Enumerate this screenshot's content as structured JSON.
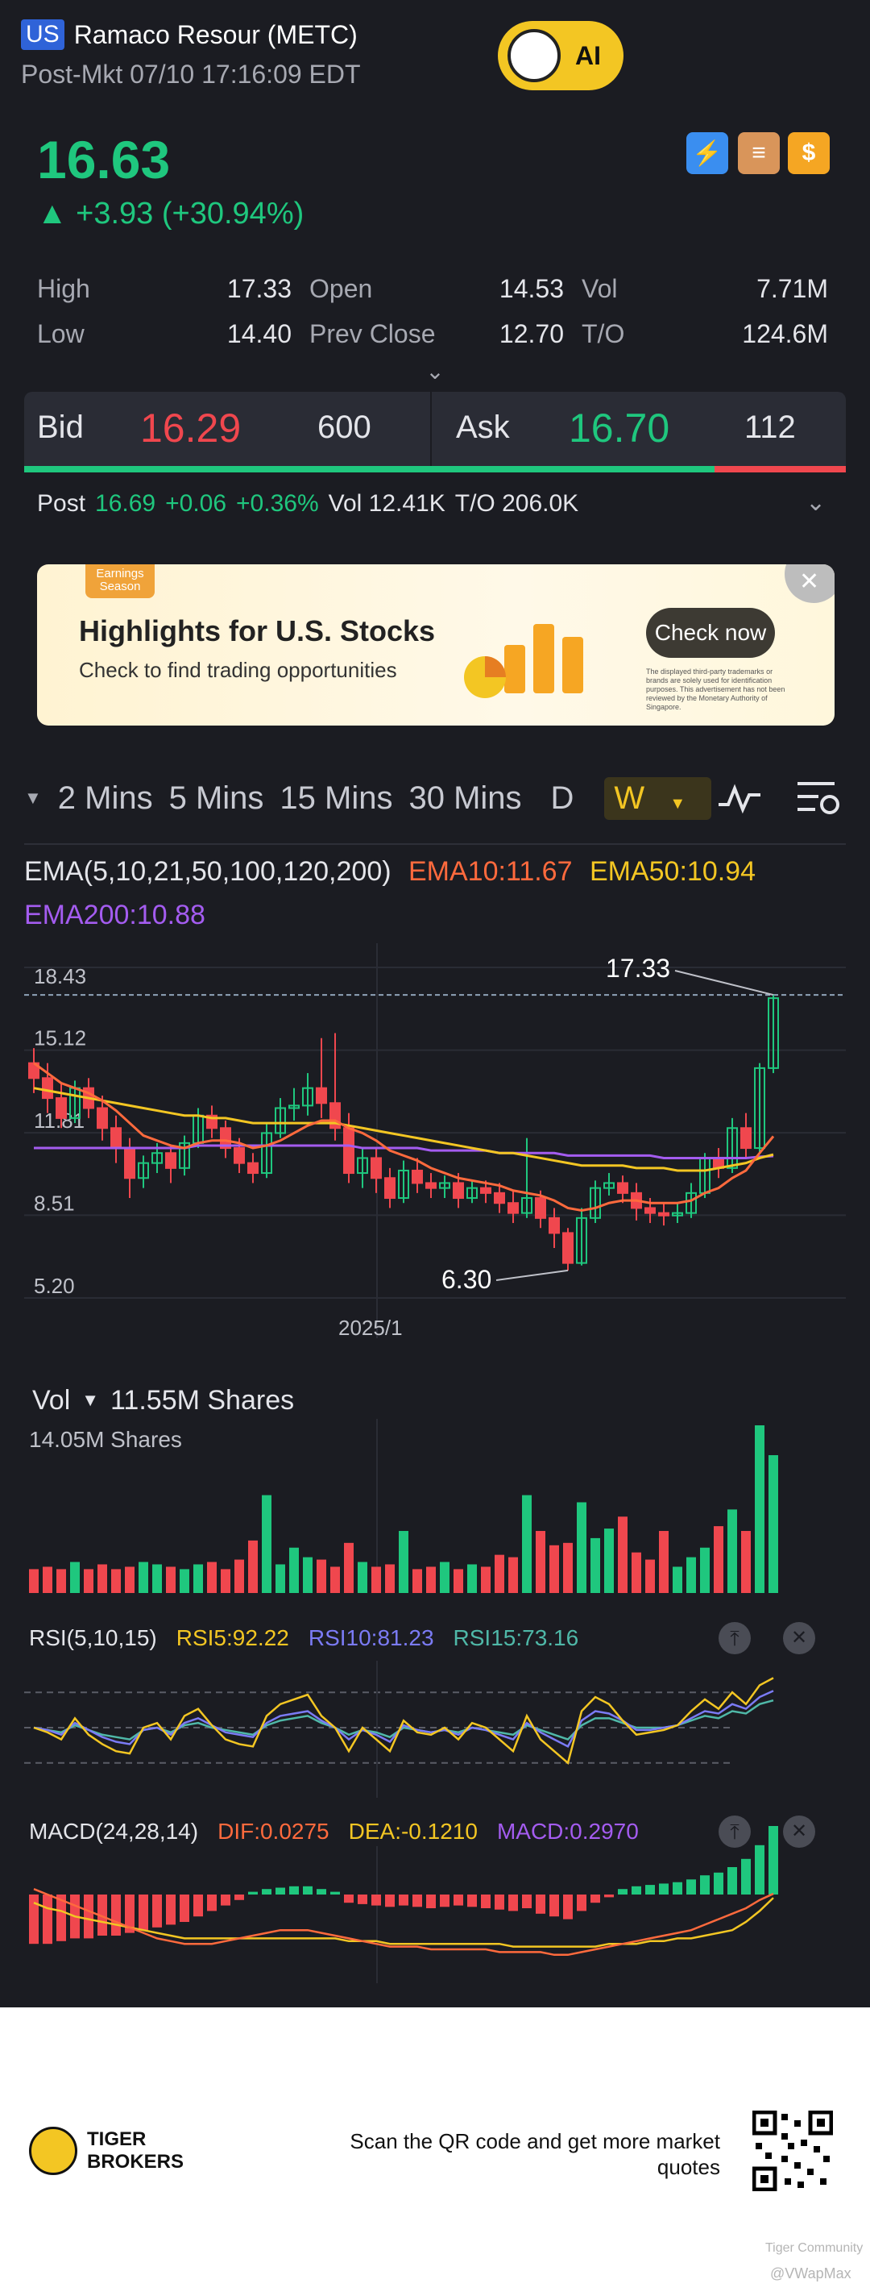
{
  "header": {
    "market_badge": "US",
    "name": "Ramaco Resour (METC)",
    "session": "Post-Mkt 07/10 17:16:09 EDT",
    "ai_label": "AI"
  },
  "quote": {
    "price": "16.63",
    "change": "▲ +3.93 (+30.94%)"
  },
  "icons": [
    {
      "name": "flash-icon",
      "glyph": "⚡",
      "sub": "1",
      "color": "#3a8ef0"
    },
    {
      "name": "stack-icon",
      "glyph": "≡",
      "color": "#e2a15a"
    },
    {
      "name": "dollar-icon",
      "glyph": "$",
      "color": "#f5a623"
    }
  ],
  "stats": [
    {
      "label": "High",
      "value": "17.33"
    },
    {
      "label": "Open",
      "value": "14.53"
    },
    {
      "label": "Vol",
      "value": "7.71M"
    },
    {
      "label": "Low",
      "value": "14.40"
    },
    {
      "label": "Prev Close",
      "value": "12.70"
    },
    {
      "label": "T/O",
      "value": "124.6M"
    }
  ],
  "bidask": {
    "bid_label": "Bid",
    "bid_price": "16.29",
    "bid_size": "600",
    "ask_label": "Ask",
    "ask_price": "16.70",
    "ask_size": "112",
    "bid_share": 0.84
  },
  "post": {
    "label": "Post",
    "price": "16.69",
    "chg": "+0.06",
    "pct": "+0.36%",
    "vol": "Vol 12.41K",
    "to": "T/O 206.0K"
  },
  "banner": {
    "tag": "Earnings Season",
    "title": "Highlights for U.S. Stocks",
    "subtitle": "Check to find trading opportunities",
    "cta": "Check now",
    "disclaimer": "The displayed third-party trademarks or brands are solely used for identification purposes. This advertisement has not been reviewed by the Monetary Authority of Singapore."
  },
  "tabs": [
    "2 Mins",
    "5 Mins",
    "15 Mins",
    "30 Mins",
    "D",
    "W"
  ],
  "ema": {
    "title": "EMA(5,10,21,50,100,120,200)",
    "ema10": "EMA10:11.67",
    "ema50": "EMA50:10.94",
    "ema200": "EMA200:10.88"
  },
  "price_axis": [
    "18.43",
    "15.12",
    "11.81",
    "8.51",
    "5.20"
  ],
  "annotations": {
    "high": "17.33",
    "low": "6.30",
    "date": "2025/1"
  },
  "vol": {
    "label": "Vol",
    "value": "11.55M Shares",
    "max": "14.05M Shares"
  },
  "rsi": {
    "title": "RSI(5,10,15)",
    "r5": "RSI5:92.22",
    "r10": "RSI10:81.23",
    "r15": "RSI15:73.16"
  },
  "macd": {
    "title": "MACD(24,28,14)",
    "dif": "DIF:0.0275",
    "dea": "DEA:-0.1210",
    "macd": "MACD:0.2970"
  },
  "footer": {
    "brand1": "TIGER",
    "brand2": "BROKERS",
    "qr_text": "Scan the QR code and get more market quotes",
    "watermark1": "Tiger Community",
    "watermark2": "@VWapMax"
  },
  "colors": {
    "up": "#1fc77e",
    "down": "#f0474e",
    "ema10": "#ff6a3d",
    "ema50": "#f3c623",
    "ema200": "#a45cf0",
    "rsi10": "#7b7bf5",
    "rsi15": "#4fb8a8"
  },
  "chart_data": {
    "type": "candlestick",
    "y_range": [
      5.2,
      18.43
    ],
    "candles": [
      [
        14.6,
        14.0,
        15.2,
        13.4
      ],
      [
        14.0,
        13.2,
        14.6,
        12.6
      ],
      [
        13.2,
        12.4,
        13.8,
        12.0
      ],
      [
        12.4,
        13.6,
        13.9,
        12.2
      ],
      [
        13.6,
        12.8,
        14.0,
        12.4
      ],
      [
        12.8,
        12.0,
        13.3,
        11.5
      ],
      [
        12.0,
        11.2,
        12.5,
        10.6
      ],
      [
        11.2,
        10.0,
        11.6,
        9.2
      ],
      [
        10.0,
        10.6,
        10.9,
        9.6
      ],
      [
        10.6,
        11.0,
        11.4,
        10.2
      ],
      [
        11.0,
        10.4,
        11.3,
        9.8
      ],
      [
        10.4,
        11.4,
        11.7,
        10.1
      ],
      [
        11.4,
        12.5,
        12.8,
        11.2
      ],
      [
        12.5,
        12.0,
        12.9,
        11.6
      ],
      [
        12.0,
        11.2,
        12.3,
        10.8
      ],
      [
        11.2,
        10.6,
        11.6,
        10.2
      ],
      [
        10.6,
        10.2,
        11.0,
        9.8
      ],
      [
        10.2,
        11.8,
        12.2,
        10.0
      ],
      [
        11.8,
        12.8,
        13.2,
        11.6
      ],
      [
        12.8,
        12.9,
        13.6,
        12.3
      ],
      [
        12.9,
        13.6,
        14.2,
        12.5
      ],
      [
        13.6,
        13.0,
        15.6,
        12.4
      ],
      [
        13.0,
        12.0,
        15.8,
        11.5
      ],
      [
        12.0,
        10.2,
        12.6,
        9.8
      ],
      [
        10.2,
        10.8,
        11.2,
        9.6
      ],
      [
        10.8,
        10.0,
        11.2,
        9.4
      ],
      [
        10.0,
        9.2,
        10.4,
        8.8
      ],
      [
        9.2,
        10.3,
        10.7,
        9.0
      ],
      [
        10.3,
        9.8,
        10.8,
        9.4
      ],
      [
        9.8,
        9.6,
        10.2,
        9.2
      ],
      [
        9.6,
        9.8,
        10.1,
        9.2
      ],
      [
        9.8,
        9.2,
        10.2,
        8.8
      ],
      [
        9.2,
        9.6,
        9.9,
        9.0
      ],
      [
        9.6,
        9.4,
        9.9,
        9.0
      ],
      [
        9.4,
        9.0,
        9.8,
        8.6
      ],
      [
        9.0,
        8.6,
        9.5,
        8.2
      ],
      [
        8.6,
        9.2,
        11.6,
        8.4
      ],
      [
        9.2,
        8.4,
        9.5,
        8.0
      ],
      [
        8.4,
        7.8,
        8.8,
        7.2
      ],
      [
        7.8,
        6.6,
        8.0,
        6.3
      ],
      [
        6.6,
        8.4,
        8.8,
        6.5
      ],
      [
        8.4,
        9.6,
        9.9,
        8.2
      ],
      [
        9.6,
        9.8,
        10.2,
        9.3
      ],
      [
        9.8,
        9.4,
        10.1,
        9.0
      ],
      [
        9.4,
        8.8,
        9.8,
        8.3
      ],
      [
        8.8,
        8.6,
        9.2,
        8.2
      ],
      [
        8.6,
        8.5,
        9.0,
        8.1
      ],
      [
        8.5,
        8.6,
        9.0,
        8.2
      ],
      [
        8.6,
        9.4,
        9.8,
        8.4
      ],
      [
        9.4,
        10.8,
        11.0,
        9.2
      ],
      [
        10.8,
        10.4,
        11.2,
        10.0
      ],
      [
        10.4,
        12.0,
        12.4,
        10.2
      ],
      [
        12.0,
        11.2,
        12.6,
        10.8
      ],
      [
        11.2,
        14.4,
        14.6,
        11.0
      ],
      [
        14.4,
        17.2,
        17.33,
        14.2
      ]
    ],
    "ema10": [
      14.6,
      14.2,
      13.8,
      13.6,
      13.4,
      13.1,
      12.7,
      12.2,
      11.7,
      11.5,
      11.3,
      11.2,
      11.4,
      11.5,
      11.5,
      11.4,
      11.2,
      11.3,
      11.5,
      11.8,
      12.1,
      12.3,
      12.3,
      12.0,
      11.8,
      11.5,
      11.1,
      10.9,
      10.7,
      10.4,
      10.2,
      10.0,
      9.9,
      9.8,
      9.7,
      9.5,
      9.4,
      9.3,
      9.1,
      8.8,
      8.7,
      8.8,
      9.0,
      9.1,
      9.1,
      9.0,
      9.0,
      9.0,
      9.1,
      9.4,
      9.6,
      10.0,
      10.3,
      11.0,
      11.67
    ],
    "ema50": [
      13.6,
      13.5,
      13.4,
      13.3,
      13.2,
      13.1,
      13.0,
      12.9,
      12.8,
      12.7,
      12.6,
      12.5,
      12.5,
      12.4,
      12.4,
      12.3,
      12.2,
      12.2,
      12.2,
      12.2,
      12.2,
      12.2,
      12.2,
      12.1,
      12.0,
      11.9,
      11.8,
      11.7,
      11.6,
      11.5,
      11.4,
      11.3,
      11.2,
      11.1,
      11.0,
      11.0,
      10.9,
      10.8,
      10.7,
      10.6,
      10.5,
      10.5,
      10.5,
      10.5,
      10.4,
      10.4,
      10.4,
      10.3,
      10.3,
      10.3,
      10.4,
      10.5,
      10.6,
      10.8,
      10.94
    ],
    "ema200": [
      11.2,
      11.2,
      11.2,
      11.2,
      11.2,
      11.2,
      11.2,
      11.2,
      11.2,
      11.2,
      11.2,
      11.2,
      11.3,
      11.3,
      11.3,
      11.3,
      11.3,
      11.3,
      11.3,
      11.3,
      11.3,
      11.3,
      11.3,
      11.3,
      11.2,
      11.2,
      11.2,
      11.2,
      11.2,
      11.1,
      11.1,
      11.1,
      11.1,
      11.1,
      11.0,
      11.0,
      11.0,
      11.0,
      11.0,
      10.9,
      10.9,
      10.9,
      10.9,
      10.9,
      10.9,
      10.9,
      10.8,
      10.8,
      10.8,
      10.8,
      10.8,
      10.8,
      10.8,
      10.85,
      10.88
    ],
    "volume": [
      2.0,
      2.2,
      2.0,
      2.6,
      2.0,
      2.4,
      2.0,
      2.2,
      2.6,
      2.4,
      2.2,
      2.0,
      2.4,
      2.6,
      2.0,
      2.8,
      4.4,
      8.2,
      2.4,
      3.8,
      3.0,
      2.8,
      2.2,
      4.2,
      2.6,
      2.2,
      2.4,
      5.2,
      2.0,
      2.2,
      2.6,
      2.0,
      2.4,
      2.2,
      3.2,
      3.0,
      8.2,
      5.2,
      4.0,
      4.2,
      7.6,
      4.6,
      5.4,
      6.4,
      3.4,
      2.8,
      5.2,
      2.2,
      3.0,
      3.8,
      5.6,
      7.0,
      5.2,
      14.05,
      11.55
    ],
    "rsi5": [
      50,
      46,
      40,
      58,
      44,
      36,
      30,
      28,
      50,
      54,
      40,
      60,
      66,
      52,
      40,
      36,
      34,
      60,
      70,
      74,
      78,
      60,
      50,
      30,
      50,
      40,
      30,
      56,
      46,
      44,
      50,
      40,
      54,
      50,
      40,
      30,
      60,
      40,
      30,
      20,
      64,
      76,
      70,
      56,
      44,
      46,
      48,
      52,
      64,
      74,
      66,
      80,
      70,
      86,
      92.22
    ],
    "rsi10": [
      50,
      48,
      44,
      54,
      48,
      42,
      38,
      36,
      48,
      50,
      44,
      54,
      58,
      52,
      46,
      44,
      42,
      54,
      60,
      62,
      64,
      56,
      50,
      40,
      48,
      44,
      38,
      52,
      48,
      46,
      48,
      44,
      50,
      48,
      44,
      40,
      54,
      46,
      40,
      34,
      56,
      64,
      62,
      56,
      48,
      48,
      50,
      52,
      58,
      64,
      62,
      70,
      66,
      76,
      81.23
    ],
    "rsi15": [
      50,
      48,
      46,
      52,
      48,
      44,
      42,
      40,
      48,
      50,
      46,
      52,
      54,
      50,
      48,
      46,
      44,
      52,
      56,
      58,
      60,
      54,
      50,
      44,
      48,
      46,
      42,
      50,
      48,
      46,
      48,
      46,
      50,
      48,
      46,
      44,
      52,
      48,
      44,
      40,
      52,
      58,
      58,
      54,
      50,
      50,
      50,
      52,
      56,
      60,
      58,
      64,
      62,
      70,
      73.16
    ],
    "macd_hist": [
      -1.8,
      -1.8,
      -1.7,
      -1.6,
      -1.6,
      -1.5,
      -1.5,
      -1.4,
      -1.3,
      -1.2,
      -1.1,
      -1.0,
      -0.8,
      -0.6,
      -0.4,
      -0.2,
      0.1,
      0.2,
      0.25,
      0.3,
      0.3,
      0.2,
      0.1,
      -0.3,
      -0.35,
      -0.4,
      -0.45,
      -0.4,
      -0.45,
      -0.5,
      -0.45,
      -0.4,
      -0.45,
      -0.5,
      -0.55,
      -0.6,
      -0.5,
      -0.7,
      -0.8,
      -0.9,
      -0.6,
      -0.3,
      -0.1,
      0.2,
      0.3,
      0.35,
      0.4,
      0.45,
      0.55,
      0.7,
      0.8,
      1.0,
      1.3,
      1.8,
      2.5
    ],
    "macd_dif": [
      0.2,
      0.0,
      -0.2,
      -0.4,
      -0.6,
      -0.8,
      -1.0,
      -1.2,
      -1.4,
      -1.6,
      -1.7,
      -1.8,
      -1.8,
      -1.8,
      -1.7,
      -1.6,
      -1.5,
      -1.4,
      -1.3,
      -1.3,
      -1.3,
      -1.4,
      -1.5,
      -1.6,
      -1.7,
      -1.8,
      -1.9,
      -1.9,
      -1.9,
      -2.0,
      -2.0,
      -2.0,
      -2.0,
      -2.0,
      -2.1,
      -2.1,
      -2.1,
      -2.1,
      -2.2,
      -2.2,
      -2.1,
      -2.0,
      -1.9,
      -1.8,
      -1.7,
      -1.6,
      -1.5,
      -1.4,
      -1.3,
      -1.1,
      -0.9,
      -0.7,
      -0.5,
      -0.2,
      0.0275
    ],
    "macd_dea": [
      -0.3,
      -0.5,
      -0.6,
      -0.8,
      -0.9,
      -1.0,
      -1.1,
      -1.2,
      -1.3,
      -1.4,
      -1.5,
      -1.6,
      -1.6,
      -1.6,
      -1.6,
      -1.6,
      -1.6,
      -1.6,
      -1.6,
      -1.6,
      -1.6,
      -1.6,
      -1.6,
      -1.7,
      -1.7,
      -1.7,
      -1.8,
      -1.8,
      -1.8,
      -1.8,
      -1.8,
      -1.8,
      -1.8,
      -1.8,
      -1.8,
      -1.9,
      -1.9,
      -1.9,
      -1.9,
      -1.9,
      -1.9,
      -1.9,
      -1.8,
      -1.8,
      -1.8,
      -1.7,
      -1.7,
      -1.6,
      -1.6,
      -1.5,
      -1.4,
      -1.3,
      -1.0,
      -0.6,
      -0.121
    ]
  }
}
